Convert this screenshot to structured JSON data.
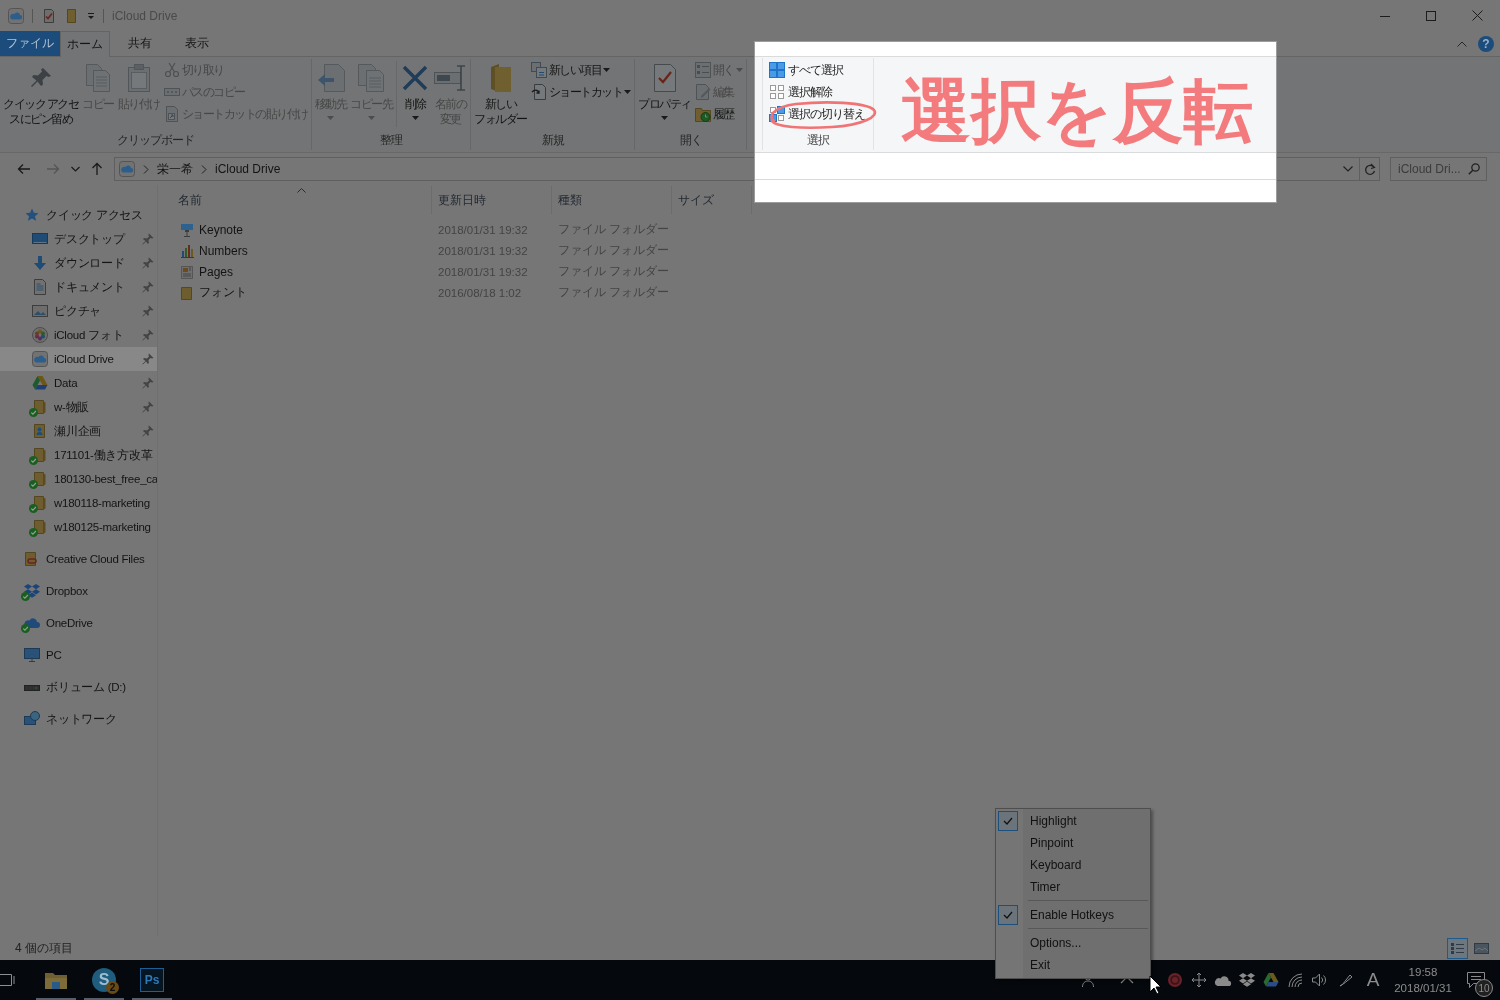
{
  "window": {
    "title": "iCloud Drive",
    "help": "?"
  },
  "ribbon": {
    "tabs": [
      {
        "label": "ファイル",
        "kind": "file",
        "selected": false
      },
      {
        "label": "ホーム",
        "kind": "tab",
        "selected": true
      },
      {
        "label": "共有",
        "kind": "tab",
        "selected": false
      },
      {
        "label": "表示",
        "kind": "tab",
        "selected": false
      }
    ],
    "groups": [
      {
        "label": "クリップボード",
        "commands": [
          {
            "kind": "large",
            "lines": [
              "クイック アクセ",
              "スにピン留め"
            ],
            "disabled": false,
            "dropdown": false
          },
          {
            "kind": "large",
            "lines": [
              "コピー"
            ],
            "disabled": true,
            "dropdown": false
          },
          {
            "kind": "large",
            "lines": [
              "貼り付け"
            ],
            "disabled": true,
            "dropdown": false
          },
          {
            "kind": "small",
            "label": "切り取り",
            "disabled": true,
            "dropdown": false
          },
          {
            "kind": "small",
            "label": "パスのコピー",
            "disabled": true,
            "dropdown": false
          },
          {
            "kind": "small",
            "label": "ショートカットの貼り付け",
            "disabled": true,
            "dropdown": false
          }
        ]
      },
      {
        "label": "整理",
        "commands": [
          {
            "kind": "large",
            "lines": [
              "移動先"
            ],
            "disabled": true,
            "dropdown": true
          },
          {
            "kind": "large",
            "lines": [
              "コピー先"
            ],
            "disabled": true,
            "dropdown": true
          },
          {
            "kind": "separator"
          },
          {
            "kind": "large",
            "lines": [
              "削除"
            ],
            "disabled": false,
            "dropdown": true
          },
          {
            "kind": "large",
            "lines": [
              "名前の",
              "変更"
            ],
            "disabled": true,
            "dropdown": false
          }
        ]
      },
      {
        "label": "新規",
        "commands": [
          {
            "kind": "large",
            "lines": [
              "新しい",
              "フォルダー"
            ],
            "disabled": false,
            "dropdown": false
          },
          {
            "kind": "small",
            "label": "新しい項目",
            "disabled": false,
            "dropdown": true
          },
          {
            "kind": "small",
            "label": "ショートカット",
            "disabled": false,
            "dropdown": true
          }
        ]
      },
      {
        "label": "開く",
        "commands": [
          {
            "kind": "large",
            "lines": [
              "プロパティ"
            ],
            "disabled": false,
            "dropdown": true
          },
          {
            "kind": "small",
            "label": "開く",
            "disabled": true,
            "dropdown": true
          },
          {
            "kind": "small",
            "label": "編集",
            "disabled": true,
            "dropdown": false
          },
          {
            "kind": "small",
            "label": "履歴",
            "disabled": false,
            "dropdown": false
          }
        ]
      }
    ]
  },
  "address_bar": {
    "nav": [
      {
        "kind": "back",
        "disabled": false
      },
      {
        "kind": "forward",
        "disabled": true
      },
      {
        "kind": "recent",
        "disabled": false
      },
      {
        "kind": "up",
        "disabled": false
      }
    ],
    "crumbs": [
      "栄一希",
      "iCloud Drive"
    ]
  },
  "search": {
    "placeholder": "iCloud Dri..."
  },
  "sidebar": {
    "items": [
      {
        "label": "クイック アクセス",
        "selected": false,
        "pinned": false,
        "synced": false,
        "children": [
          {
            "label": "デスクトップ",
            "selected": false,
            "pinned": true,
            "synced": false
          },
          {
            "label": "ダウンロード",
            "selected": false,
            "pinned": true,
            "synced": false
          },
          {
            "label": "ドキュメント",
            "selected": false,
            "pinned": true,
            "synced": false
          },
          {
            "label": "ピクチャ",
            "selected": false,
            "pinned": true,
            "synced": false
          },
          {
            "label": "iCloud フォト",
            "selected": false,
            "pinned": true,
            "synced": false
          },
          {
            "label": "iCloud Drive",
            "selected": true,
            "pinned": true,
            "synced": false
          },
          {
            "label": "Data",
            "selected": false,
            "pinned": true,
            "synced": false
          },
          {
            "label": "w-物販",
            "selected": false,
            "pinned": true,
            "synced": true
          },
          {
            "label": "瀬川企画",
            "selected": false,
            "pinned": true,
            "synced": false
          },
          {
            "label": "171101-働き方改革",
            "selected": false,
            "pinned": false,
            "synced": true
          },
          {
            "label": "180130-best_free_ca",
            "selected": false,
            "pinned": false,
            "synced": true
          },
          {
            "label": "w180118-marketing",
            "selected": false,
            "pinned": false,
            "synced": true
          },
          {
            "label": "w180125-marketing",
            "selected": false,
            "pinned": false,
            "synced": true
          }
        ]
      },
      {
        "label": "Creative Cloud Files",
        "selected": false,
        "pinned": false,
        "synced": false
      },
      {
        "label": "Dropbox",
        "selected": false,
        "pinned": false,
        "synced": true
      },
      {
        "label": "OneDrive",
        "selected": false,
        "pinned": false,
        "synced": true
      },
      {
        "label": "PC",
        "selected": false,
        "pinned": false,
        "synced": false
      },
      {
        "label": "ボリューム (D:)",
        "selected": false,
        "pinned": false,
        "synced": false
      },
      {
        "label": "ネットワーク",
        "selected": false,
        "pinned": false,
        "synced": false
      }
    ]
  },
  "file_list": {
    "columns": [
      {
        "label": "名前",
        "sorted": true
      },
      {
        "label": "更新日時",
        "sorted": false
      },
      {
        "label": "種類",
        "sorted": false
      },
      {
        "label": "サイズ",
        "sorted": false
      }
    ],
    "rows": [
      {
        "name": "Keynote",
        "modified": "2018/01/31 19:32",
        "type": "ファイル フォルダー",
        "selected": false
      },
      {
        "name": "Numbers",
        "modified": "2018/01/31 19:32",
        "type": "ファイル フォルダー",
        "selected": false
      },
      {
        "name": "Pages",
        "modified": "2018/01/31 19:32",
        "type": "ファイル フォルダー",
        "selected": false
      },
      {
        "name": "フォント",
        "modified": "2016/08/18 1:02",
        "type": "ファイル フォルダー",
        "selected": false
      }
    ]
  },
  "status_bar": {
    "item_count": "4 個の項目",
    "views": [
      {
        "kind": "details",
        "selected": true
      },
      {
        "kind": "large-icons",
        "selected": false
      }
    ]
  },
  "spotlight": {
    "group": {
      "label": "選択",
      "commands": [
        {
          "label": "すべて選択",
          "disabled": false,
          "circled": false
        },
        {
          "label": "選択解除",
          "disabled": false,
          "circled": false
        },
        {
          "label": "選択の切り替え",
          "disabled": false,
          "circled": true
        }
      ]
    },
    "annotation": "選択を反転"
  },
  "tray_menu": {
    "sections": [
      {
        "items": [
          {
            "label": "Highlight",
            "checked": true
          },
          {
            "label": "Pinpoint",
            "checked": false
          },
          {
            "label": "Keyboard",
            "checked": false
          },
          {
            "label": "Timer",
            "checked": false
          }
        ]
      },
      {
        "items": [
          {
            "label": "Enable Hotkeys",
            "checked": true
          }
        ]
      },
      {
        "items": [
          {
            "label": "Options...",
            "checked": false
          },
          {
            "label": "Exit",
            "checked": false
          }
        ]
      }
    ]
  },
  "taskbar": {
    "apps": [
      {
        "kind": "explorer",
        "running": true
      },
      {
        "kind": "skype",
        "logo": "S",
        "badge": "2",
        "running": true
      },
      {
        "kind": "photoshop",
        "logo": "Ps",
        "running": true
      }
    ],
    "ime": "A",
    "time": "19:58",
    "date": "2018/01/31",
    "notifications": "10"
  }
}
